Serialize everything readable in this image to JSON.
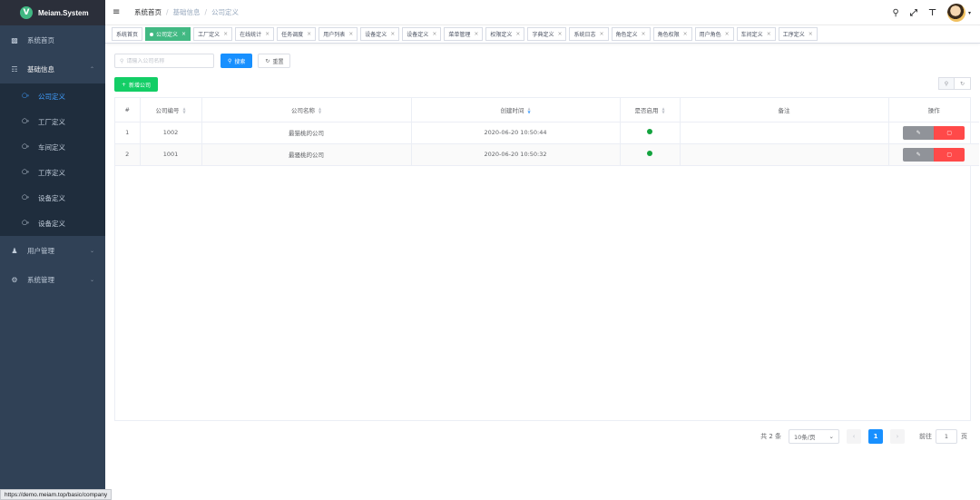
{
  "sidebar": {
    "brand": {
      "logo": "V",
      "name": "Meiam.System"
    },
    "items": [
      {
        "label": "系统首页",
        "icon": "dashboard-icon"
      },
      {
        "label": "基础信息",
        "icon": "sitemap-icon",
        "open": true,
        "children": [
          {
            "label": "公司定义",
            "icon": "cube-icon",
            "active": true
          },
          {
            "label": "工厂定义",
            "icon": "cube-icon"
          },
          {
            "label": "车间定义",
            "icon": "cube-icon"
          },
          {
            "label": "工序定义",
            "icon": "cube-icon"
          },
          {
            "label": "设备定义",
            "icon": "cube-icon"
          },
          {
            "label": "设备定义",
            "icon": "cube-icon"
          }
        ]
      },
      {
        "label": "用户管理",
        "icon": "users-icon"
      },
      {
        "label": "系统管理",
        "icon": "gear-icon"
      }
    ]
  },
  "navbar": {
    "breadcrumb": [
      "系统首页",
      "基础信息",
      "公司定义"
    ],
    "icons": [
      "search-icon",
      "fullscreen-icon",
      "font-size-icon",
      "avatar"
    ]
  },
  "tags": [
    {
      "label": "系统首页",
      "closable": false
    },
    {
      "label": "公司定义",
      "active": true
    },
    {
      "label": "工厂定义"
    },
    {
      "label": "在线统计"
    },
    {
      "label": "任务调度"
    },
    {
      "label": "用户列表"
    },
    {
      "label": "设备定义"
    },
    {
      "label": "设备定义"
    },
    {
      "label": "菜单管理"
    },
    {
      "label": "权限定义"
    },
    {
      "label": "字典定义"
    },
    {
      "label": "系统日志"
    },
    {
      "label": "角色定义"
    },
    {
      "label": "角色权限"
    },
    {
      "label": "用户角色"
    },
    {
      "label": "车间定义"
    },
    {
      "label": "工序定义"
    }
  ],
  "search": {
    "placeholder": "请输入公司名称",
    "value": "",
    "search_label": "搜索",
    "reset_label": "重置"
  },
  "actions": {
    "add_label": "新增公司"
  },
  "table": {
    "columns": [
      "#",
      "公司编号",
      "公司名称",
      "创建时间",
      "是否启用",
      "备注",
      "操作"
    ],
    "rows": [
      {
        "index": "1",
        "code": "1002",
        "name": "最猫桃的公司",
        "created": "2020-06-20 10:50:44",
        "enabled": true,
        "remark": ""
      },
      {
        "index": "2",
        "code": "1001",
        "name": "最骚桃的公司",
        "created": "2020-06-20 10:50:32",
        "enabled": true,
        "remark": ""
      }
    ]
  },
  "pagination": {
    "total_label": "共 2 条",
    "page_size": "10条/页",
    "current_page": "1",
    "goto_label": "前往",
    "goto_value": "1",
    "page_suffix": "页"
  },
  "status_bar": {
    "url": "https://demo.meiam.top/basic/company"
  },
  "colors": {
    "sidebar_bg": "#304156",
    "active_blue": "#409eff",
    "tag_active": "#42b983",
    "success": "#13ce66",
    "danger": "#ff4949"
  }
}
